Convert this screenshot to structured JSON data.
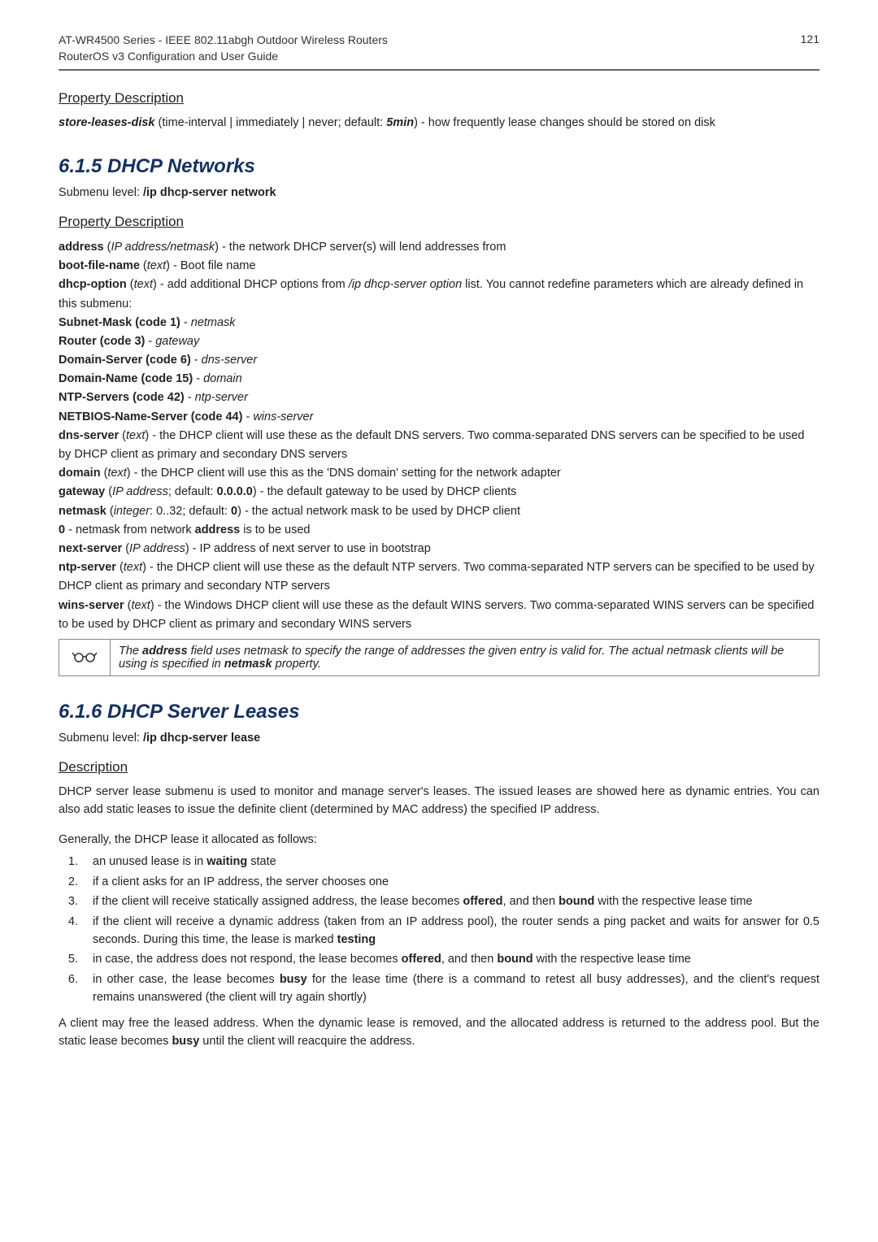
{
  "header": {
    "line1": "AT-WR4500 Series - IEEE 802.11abgh Outdoor Wireless Routers",
    "line2": "RouterOS v3 Configuration and User Guide",
    "pageno": "121"
  },
  "sec_propdesc1": {
    "title": "Property Description",
    "body_html": "<b><i>store-leases-disk</i></b> (time-interval | immediately | never; default: <b><i>5min</i></b>) - how frequently lease changes should be stored on disk"
  },
  "sec_615": {
    "heading": "6.1.5  DHCP Networks",
    "submenu_html": "Submenu level: <b>/ip dhcp-server network</b>",
    "propdesc_title": "Property Description",
    "body_html": "<span class='line'><b>address</b> (<i>IP address/netmask</i>) - the network DHCP server(s) will lend addresses from</span><span class='line'><b>boot-file-name</b> (<i>text</i>) - Boot file name</span><span class='line'><b>dhcp-option</b> (<i>text</i>) - add additional DHCP options from <i>/ip dhcp-server option</i> list. You cannot redefine parameters which are already defined in this submenu:</span><span class='line'><b>Subnet-Mask (code 1)</b> - <i>netmask</i></span><span class='line'><b>Router (code 3)</b> - <i>gateway</i></span><span class='line'><b>Domain-Server (code 6)</b> - <i>dns-server</i></span><span class='line'><b>Domain-Name (code 15)</b> - <i>domain</i></span><span class='line'><b>NTP-Servers (code 42)</b> - <i>ntp-server</i></span><span class='line'><b>NETBIOS-Name-Server (code 44)</b> - <i>wins-server</i></span><span class='line'><b>dns-server</b> (<i>text</i>) - the DHCP client will use these as the default DNS servers. Two comma-separated DNS servers can be specified to be used by DHCP client as primary and secondary DNS servers</span><span class='line'><b>domain</b> (<i>text</i>) - the DHCP client will use this as the 'DNS domain' setting for the network adapter</span><span class='line'><b>gateway</b> (<i>IP address</i>; default: <b>0.0.0.0</b>) - the default gateway to be used by DHCP clients</span><span class='line'><b>netmask</b> (<i>integer</i>: 0..32; default: <b>0</b>) - the actual network mask to be used by DHCP client</span><span class='line'><b>0</b> - netmask from network <b>address</b> is to be used</span><span class='line'><b>next-server</b> (<i>IP address</i>) - IP address of next server to use in bootstrap</span><span class='line'><b>ntp-server</b> (<i>text</i>) - the DHCP client will use these as the default NTP servers. Two comma-separated NTP servers can be specified to be used by DHCP client as primary and secondary NTP servers</span><span class='line'><b>wins-server</b> (<i>text</i>) - the Windows DHCP client will use these as the default WINS servers. Two comma-separated WINS servers can be specified to be used by DHCP client as primary and secondary WINS servers</span>",
    "note_html": "The <b>address</b> field uses netmask to specify the range of addresses the given entry is valid for. The actual netmask clients will be using is specified in <b>netmask</b> property."
  },
  "sec_616": {
    "heading": "6.1.6  DHCP Server Leases",
    "submenu_html": "Submenu level: <b>/ip dhcp-server lease</b>",
    "desc_title": "Description",
    "intro_html": "DHCP server lease submenu is used to monitor and manage server's leases. The issued leases are showed here as dynamic entries. You can also add static leases to issue the definite client (determined by MAC address) the specified IP address.",
    "generally": "Generally, the DHCP lease it allocated as follows:",
    "steps_html": [
      "an unused lease is in <b>waiting</b> state",
      "if a client asks for an IP address, the server chooses one",
      "if the client will receive statically assigned address, the lease becomes <b>offered</b>, and then <b>bound</b> with the respective lease time",
      "if the client will receive a dynamic address (taken from an IP address pool), the router sends a ping packet and waits for answer for 0.5 seconds. During this time, the lease is marked <b>testing</b>",
      "in case, the address does not respond, the lease becomes <b>offered</b>, and then <b>bound</b> with the respective lease time",
      "in other case, the lease becomes <b>busy</b> for the lease time (there is a command to retest all busy addresses), and the client's request remains unanswered (the client will try again shortly)"
    ],
    "tail_html": "A client may free the leased address. When the dynamic lease is removed, and the allocated address is returned to the address pool. But the static lease becomes <b>busy</b> until the client will reacquire the address."
  }
}
